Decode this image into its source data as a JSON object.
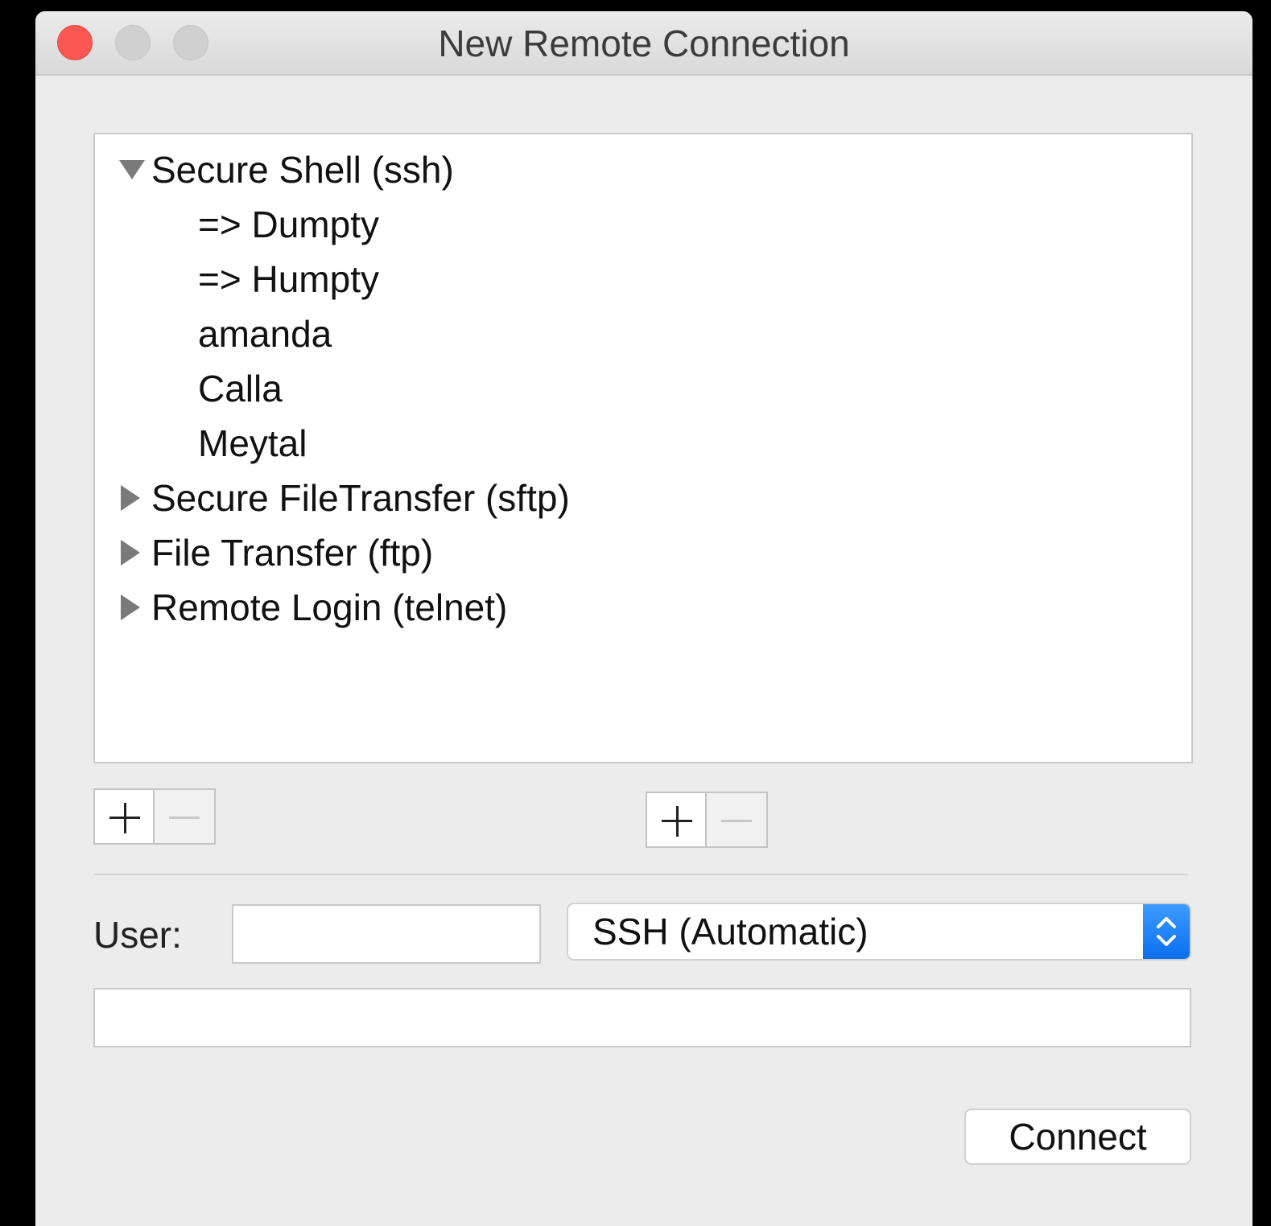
{
  "window": {
    "title": "New Remote Connection"
  },
  "services": {
    "groups": [
      {
        "label": "Secure Shell (ssh)",
        "expanded": true,
        "items": [
          "=> Dumpty",
          "=> Humpty",
          "amanda",
          "Calla",
          "Meytal"
        ]
      },
      {
        "label": "Secure FileTransfer (sftp)",
        "expanded": false
      },
      {
        "label": "File Transfer (ftp)",
        "expanded": false
      },
      {
        "label": "Remote Login (telnet)",
        "expanded": false
      }
    ]
  },
  "form": {
    "user_label": "User:",
    "user_value": "",
    "protocol_selected": "SSH (Automatic)",
    "host_value": "",
    "connect_label": "Connect"
  },
  "colors": {
    "close": "#fc5753",
    "accent": "#0a6ff0",
    "window_bg": "#ececec"
  }
}
